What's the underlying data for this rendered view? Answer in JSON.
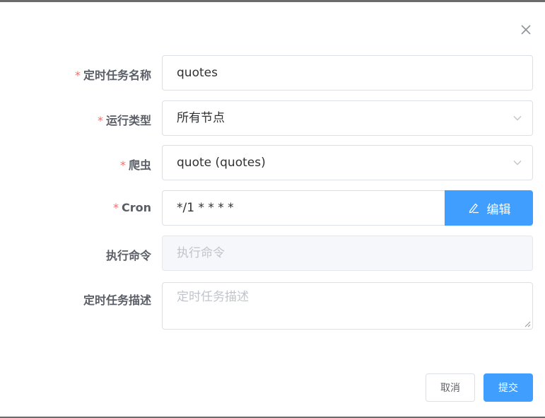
{
  "dialog": {
    "close_icon": "close-icon"
  },
  "form": {
    "task_name": {
      "label": "定时任务名称",
      "required_mark": "*",
      "value": "quotes"
    },
    "run_type": {
      "label": "运行类型",
      "required_mark": "*",
      "value": "所有节点"
    },
    "spider": {
      "label": "爬虫",
      "required_mark": "*",
      "value": "quote (quotes)"
    },
    "cron": {
      "label": "Cron",
      "required_mark": "*",
      "value": "*/1 * * * *",
      "edit_label": "编辑"
    },
    "command": {
      "label": "执行命令",
      "placeholder": "执行命令"
    },
    "description": {
      "label": "定时任务描述",
      "placeholder": "定时任务描述"
    }
  },
  "footer": {
    "cancel_label": "取消",
    "submit_label": "提交"
  },
  "colors": {
    "primary": "#409eff",
    "required": "#f56c6c",
    "border": "#dcdfe6"
  }
}
